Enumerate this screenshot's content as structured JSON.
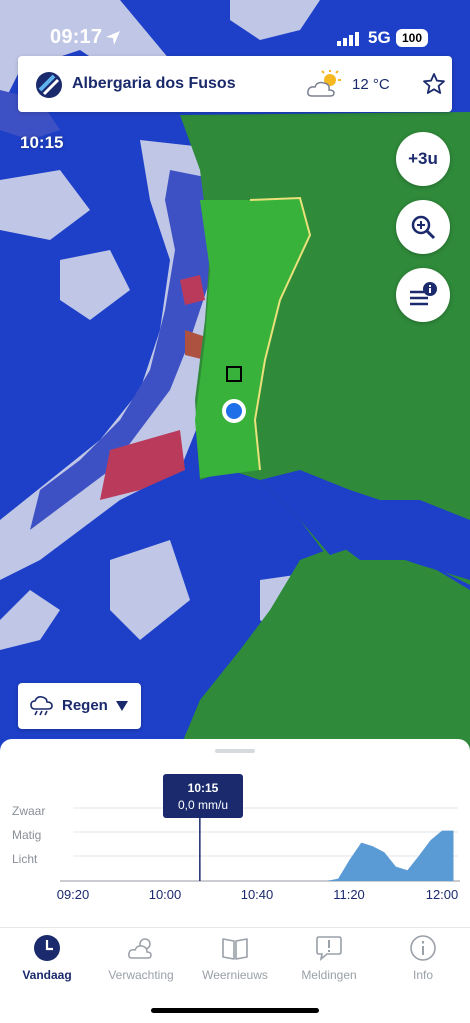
{
  "status_bar": {
    "time": "09:17",
    "network": "5G",
    "battery": "100"
  },
  "location": {
    "name": "Albergaria dos Fusos",
    "temperature": "12 °C",
    "weather_icon": "partly-cloudy-icon"
  },
  "map": {
    "time": "10:15",
    "plus_button_label": "+3u",
    "layer_button_label": "Regen",
    "colors": {
      "sea": "#1e40c8",
      "land": "#2f8a3a",
      "light_rain": "#c9cfe8",
      "moderate_rain": "#3f52c4",
      "heavy_rain": "#c23a55",
      "forecast_area": "#38b23a",
      "border": "#e9e27a"
    }
  },
  "forecast_sheet": {
    "categories": [
      "Zwaar",
      "Matig",
      "Licht"
    ],
    "tooltip": {
      "time": "10:15",
      "value": "0,0 mm/u"
    },
    "x_ticks": [
      "09:20",
      "10:00",
      "10:40",
      "11:20",
      "12:00"
    ]
  },
  "chart_data": {
    "type": "area",
    "xlabel": "",
    "ylabel": "",
    "categories_y": [
      "Licht",
      "Matig",
      "Zwaar"
    ],
    "x": [
      "09:20",
      "10:00",
      "10:40",
      "11:10",
      "11:15",
      "11:20",
      "11:25",
      "11:30",
      "11:35",
      "11:40",
      "11:45",
      "11:50",
      "11:55",
      "12:00",
      "12:05"
    ],
    "values": [
      0,
      0,
      0,
      0,
      0.1,
      0.9,
      1.6,
      1.45,
      1.2,
      0.6,
      0.45,
      1.05,
      1.7,
      2.1,
      2.1
    ],
    "marker_time": "10:15",
    "color": "#5b9bd5"
  },
  "tabs": [
    {
      "label": "Vandaag",
      "icon": "clock-icon",
      "active": true
    },
    {
      "label": "Verwachting",
      "icon": "cloud-sun-icon",
      "active": false
    },
    {
      "label": "Weernieuws",
      "icon": "book-icon",
      "active": false
    },
    {
      "label": "Meldingen",
      "icon": "alert-bubble-icon",
      "active": false
    },
    {
      "label": "Info",
      "icon": "info-icon",
      "active": false
    }
  ]
}
